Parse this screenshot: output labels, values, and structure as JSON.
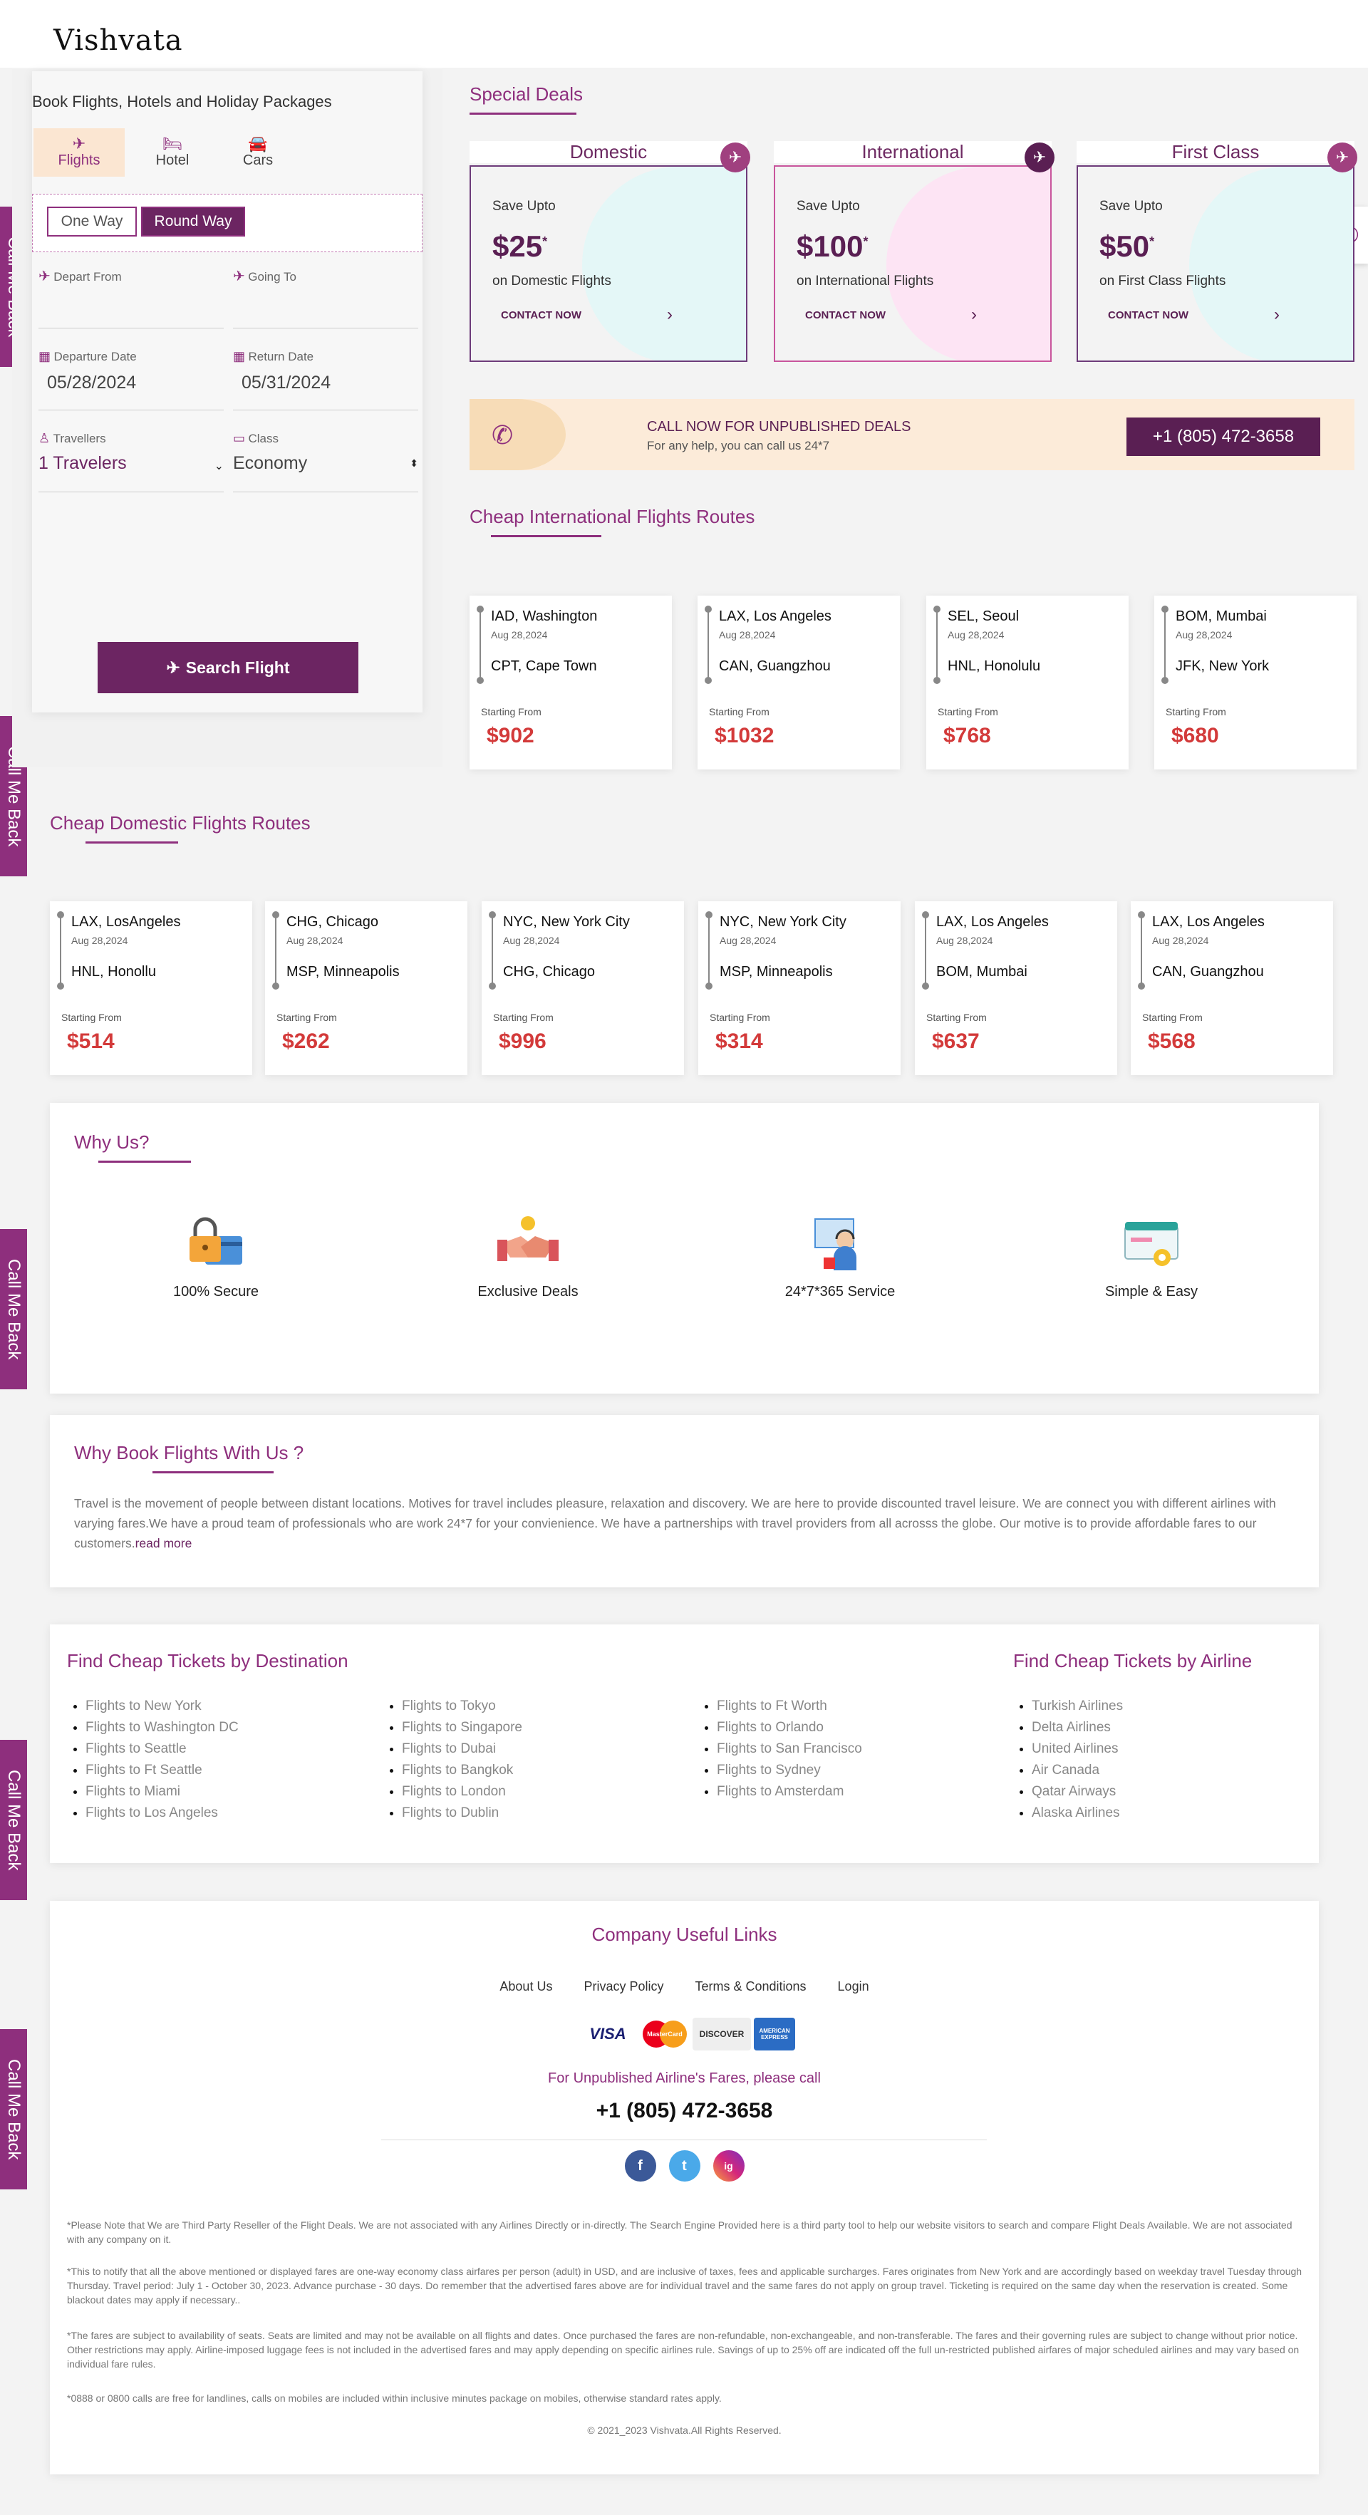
{
  "header": {
    "logo": "Vishvata"
  },
  "side_tab_label": "Call Me Back",
  "booking": {
    "title": "Book Flights, Hotels and Holiday Packages",
    "tabs": [
      {
        "label": "Flights",
        "icon": "plane-icon"
      },
      {
        "label": "Hotel",
        "icon": "bed-icon"
      },
      {
        "label": "Cars",
        "icon": "car-icon"
      }
    ],
    "trip_types": [
      "One Way",
      "Round Way"
    ],
    "depart_from_label": "Depart From",
    "going_to_label": "Going To",
    "departure_date_label": "Departure Date",
    "departure_date": "05/28/2024",
    "return_date_label": "Return Date",
    "return_date": "05/31/2024",
    "travellers_label": "Travellers",
    "travellers_value": "1 Travelers",
    "class_label": "Class",
    "class_value": "Economy",
    "search_label": "Search Flight"
  },
  "special_deals": {
    "heading": "Special Deals",
    "deals": [
      {
        "title": "Domestic",
        "save": "Save Upto",
        "price": "$25",
        "sup": "*",
        "sub": "on Domestic Flights",
        "cta": "CONTACT NOW",
        "blob": "#e4f7f7"
      },
      {
        "title": "International",
        "save": "Save Upto",
        "price": "$100",
        "sup": "*",
        "sub": "on International Flights",
        "cta": "CONTACT NOW",
        "blob": "#fde4f4"
      },
      {
        "title": "First Class",
        "save": "Save Upto",
        "price": "$50",
        "sup": "*",
        "sub": "on First Class Flights",
        "cta": "CONTACT NOW",
        "blob": "#e4f7f7"
      }
    ]
  },
  "call_banner": {
    "title": "CALL NOW FOR UNPUBLISHED DEALS",
    "subtitle": "For any help, you can call us 24*7",
    "phone": "+1 (805) 472-3658"
  },
  "intl_routes": {
    "heading": "Cheap International Flights Routes",
    "items": [
      {
        "from": "IAD, Washington",
        "date": "Aug 28,2024",
        "to": "CPT, Cape Town",
        "label": "Starting From",
        "price": "$902"
      },
      {
        "from": "LAX, Los Angeles",
        "date": "Aug 28,2024",
        "to": "CAN, Guangzhou",
        "label": "Starting From",
        "price": "$1032"
      },
      {
        "from": "SEL, Seoul",
        "date": "Aug 28,2024",
        "to": "HNL, Honolulu",
        "label": "Starting From",
        "price": "$768"
      },
      {
        "from": "BOM, Mumbai",
        "date": "Aug 28,2024",
        "to": "JFK, New York",
        "label": "Starting From",
        "price": "$680"
      }
    ]
  },
  "dom_routes": {
    "heading": "Cheap Domestic Flights Routes",
    "items": [
      {
        "from": "LAX, LosAngeles",
        "date": "Aug 28,2024",
        "to": "HNL, Honollu",
        "label": "Starting From",
        "price": "$514"
      },
      {
        "from": "CHG, Chicago",
        "date": "Aug 28,2024",
        "to": "MSP, Minneapolis",
        "label": "Starting From",
        "price": "$262"
      },
      {
        "from": "NYC, New York City",
        "date": "Aug 28,2024",
        "to": "CHG, Chicago",
        "label": "Starting From",
        "price": "$996"
      },
      {
        "from": "NYC, New York City",
        "date": "Aug 28,2024",
        "to": "MSP, Minneapolis",
        "label": "Starting From",
        "price": "$314"
      },
      {
        "from": "LAX, Los Angeles",
        "date": "Aug 28,2024",
        "to": "BOM, Mumbai",
        "label": "Starting From",
        "price": "$637"
      },
      {
        "from": "LAX, Los Angeles",
        "date": "Aug 28,2024",
        "to": "CAN, Guangzhou",
        "label": "Starting From",
        "price": "$568"
      }
    ]
  },
  "why_us": {
    "heading": "Why Us?",
    "features": [
      {
        "label": "100% Secure",
        "icon": "secure-lock-icon"
      },
      {
        "label": "Exclusive Deals",
        "icon": "handshake-icon"
      },
      {
        "label": "24*7*365 Service",
        "icon": "support-agent-icon"
      },
      {
        "label": "Simple & Easy",
        "icon": "easy-booking-icon"
      }
    ]
  },
  "why_book": {
    "heading": "Why Book Flights With Us ?",
    "text": "Travel is the movement of people between distant locations. Motives for travel includes pleasure, relaxation and discovery. We are here to provide discounted travel leisure. We are connect you with different airlines with varying fares.We have a proud team of professionals who are work 24*7 for your convienience. We have a partnerships with travel providers from all acrosss the globe. Our motive is to provide affordable fares to our customers.",
    "read_more": "read more"
  },
  "cheap_tickets": {
    "dest_heading": "Find Cheap Tickets by Destination",
    "airline_heading": "Find Cheap Tickets by Airline",
    "col1": [
      "Flights to New York",
      "Flights to Washington DC",
      "Flights to Seattle",
      "Flights to Ft Seattle",
      "Flights to Miami",
      "Flights to Los Angeles"
    ],
    "col2": [
      "Flights to Tokyo",
      "Flights to Singapore",
      "Flights to Dubai",
      "Flights to Bangkok",
      "Flights to London",
      "Flights to Dublin"
    ],
    "col3": [
      "Flights to Ft Worth",
      "Flights to Orlando",
      "Flights to San Francisco",
      "Flights to Sydney",
      "Flights to Amsterdam"
    ],
    "airlines": [
      "Turkish Airlines",
      "Delta Airlines",
      "United Airlines",
      "Air Canada",
      "Qatar Airways",
      "Alaska Airlines"
    ]
  },
  "footer": {
    "heading": "Company Useful Links",
    "links": [
      "About Us",
      "Privacy Policy",
      "Terms & Conditions",
      "Login"
    ],
    "card_logos": [
      "VISA",
      "MasterCard",
      "DISCOVER",
      "AMERICAN EXPRESS"
    ],
    "unpublished": "For Unpublished Airline's Fares, please call",
    "phone": "+1 (805) 472-3658",
    "social": [
      "f",
      "t",
      "ig"
    ],
    "disclaimers": [
      "*Please Note that We are Third Party Reseller of the Flight Deals. We are not associated with any Airlines Directly or in-directly. The Search Engine Provided here is a third party tool to help our website visitors to search and compare Flight Deals Available. We are not associated with any company on it.",
      "*This to notify that all the above mentioned or displayed fares are one-way economy class airfares per person (adult) in USD, and are inclusive of taxes, fees and applicable surcharges. Fares originates from New York and are accordingly based on weekday travel Tuesday through Thursday. Travel period: July 1 - October 30, 2023. Advance purchase - 30 days. Do remember that the advertised fares above are for individual travel and the same fares do not apply on group travel. Ticketing is required on the same day when the reservation is created. Some blackout dates may apply if necessary..",
      "*The fares are subject to availability of seats. Seats are limited and may not be available on all flights and dates. Once purchased the fares are non-refundable, non-exchangeable, and non-transferable. The fares and their governing rules are subject to change without prior notice. Other restrictions may apply. Airline-imposed luggage fees is not included in the advertised fares and may apply depending on specific airlines rule. Savings of up to 25% off are indicated off the full un-restricted published airfares of major scheduled airlines and may vary based on individual fare rules.",
      "*0888 or 0800 calls are free for landlines, calls on mobiles are included within inclusive minutes package on mobiles, otherwise standard rates apply."
    ],
    "copyright": "© 2021_2023 Vishvata.All Rights Reserved."
  },
  "colors": {
    "brand": "#8e2f7d",
    "dark": "#5a1f53",
    "price": "#d33a3a",
    "banner": "#fcebd9"
  }
}
